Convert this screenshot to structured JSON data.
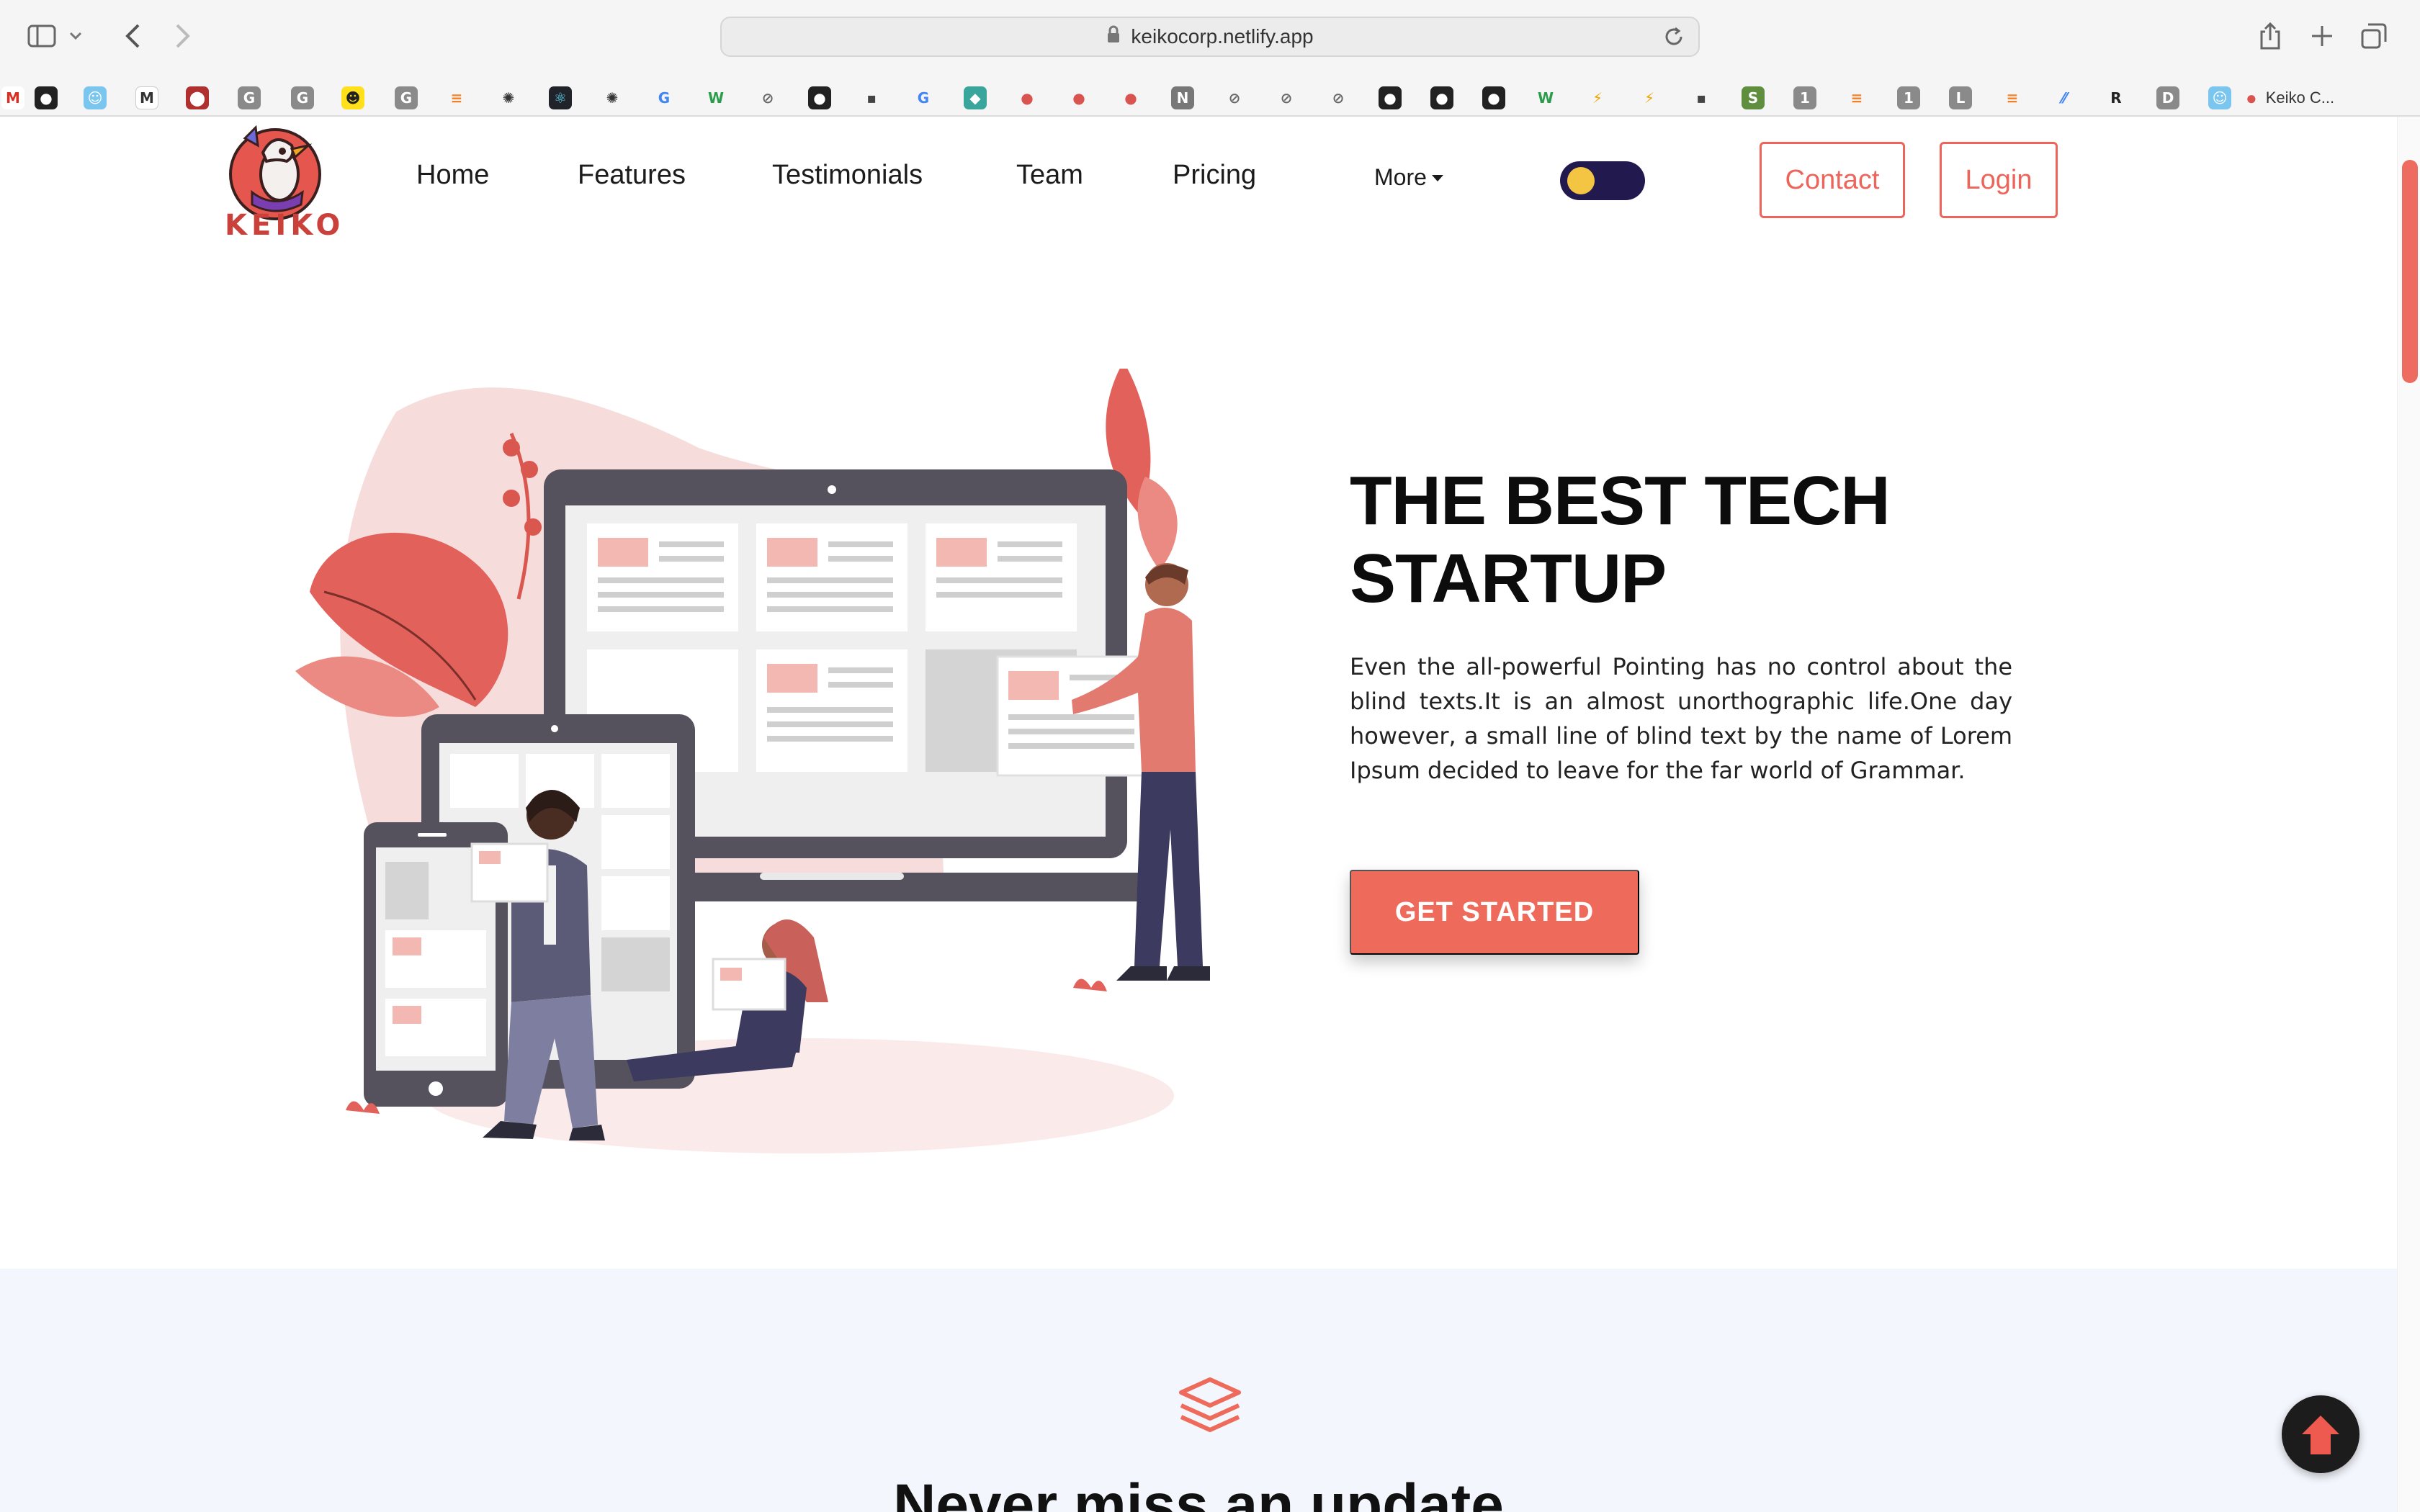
{
  "browser": {
    "url": "keikocorp.netlify.app",
    "tab_title": "Keiko C...",
    "bookmark_icons": [
      "gmail-icon",
      "github-icon",
      "app-icon",
      "medium-icon",
      "app-icon",
      "g-icon",
      "g-icon",
      "mailchimp-icon",
      "g-icon",
      "stackoverflow-icon",
      "openai-icon",
      "react-icon",
      "openai-icon",
      "google-icon",
      "webflow-icon",
      "safari-icon",
      "github-icon",
      "app-icon",
      "google-icon",
      "diamond-icon",
      "keiko-icon",
      "keiko-icon",
      "keiko-icon",
      "notion-icon",
      "safari-icon",
      "safari-icon",
      "safari-icon",
      "github-icon",
      "github-icon",
      "github-icon",
      "webflow-icon",
      "bolt-icon",
      "bolt-icon",
      "app-icon",
      "shopify-icon",
      "one-icon",
      "stackoverflow-icon",
      "one-icon",
      "l-icon",
      "stackoverflow-icon",
      "slash-icon",
      "r-icon",
      "d-icon",
      "app-icon"
    ]
  },
  "nav": {
    "logo_text": "KEIKO",
    "links": [
      "Home",
      "Features",
      "Testimonials",
      "Team",
      "Pricing"
    ],
    "more": "More",
    "contact": "Contact",
    "login": "Login"
  },
  "hero": {
    "title_line1": "THE BEST TECH",
    "title_line2": "STARTUP",
    "text": "Even the all-powerful Pointing has no control about the blind texts.It is an almost unorthographic life.One day however, a small line of blind text by the name of Lorem Ipsum decided to leave for the far world of Grammar.",
    "cta": "GET STARTED"
  },
  "section2": {
    "title": "Never miss an update"
  },
  "colors": {
    "accent": "#ee6a5b",
    "dark": "#221a4e",
    "toggle_knob": "#f4c443",
    "section_bg": "#f3f6fc"
  }
}
